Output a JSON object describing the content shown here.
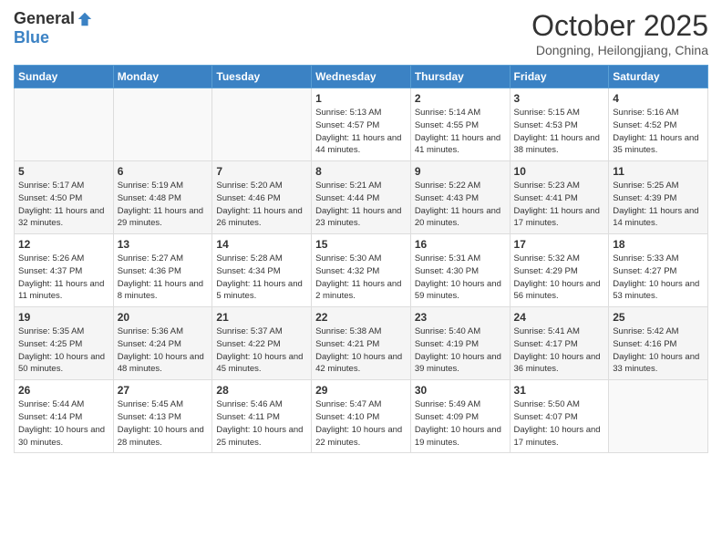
{
  "header": {
    "logo_general": "General",
    "logo_blue": "Blue",
    "month": "October 2025",
    "location": "Dongning, Heilongjiang, China"
  },
  "weekdays": [
    "Sunday",
    "Monday",
    "Tuesday",
    "Wednesday",
    "Thursday",
    "Friday",
    "Saturday"
  ],
  "weeks": [
    [
      {
        "day": "",
        "sunrise": "",
        "sunset": "",
        "daylight": ""
      },
      {
        "day": "",
        "sunrise": "",
        "sunset": "",
        "daylight": ""
      },
      {
        "day": "",
        "sunrise": "",
        "sunset": "",
        "daylight": ""
      },
      {
        "day": "1",
        "sunrise": "Sunrise: 5:13 AM",
        "sunset": "Sunset: 4:57 PM",
        "daylight": "Daylight: 11 hours and 44 minutes."
      },
      {
        "day": "2",
        "sunrise": "Sunrise: 5:14 AM",
        "sunset": "Sunset: 4:55 PM",
        "daylight": "Daylight: 11 hours and 41 minutes."
      },
      {
        "day": "3",
        "sunrise": "Sunrise: 5:15 AM",
        "sunset": "Sunset: 4:53 PM",
        "daylight": "Daylight: 11 hours and 38 minutes."
      },
      {
        "day": "4",
        "sunrise": "Sunrise: 5:16 AM",
        "sunset": "Sunset: 4:52 PM",
        "daylight": "Daylight: 11 hours and 35 minutes."
      }
    ],
    [
      {
        "day": "5",
        "sunrise": "Sunrise: 5:17 AM",
        "sunset": "Sunset: 4:50 PM",
        "daylight": "Daylight: 11 hours and 32 minutes."
      },
      {
        "day": "6",
        "sunrise": "Sunrise: 5:19 AM",
        "sunset": "Sunset: 4:48 PM",
        "daylight": "Daylight: 11 hours and 29 minutes."
      },
      {
        "day": "7",
        "sunrise": "Sunrise: 5:20 AM",
        "sunset": "Sunset: 4:46 PM",
        "daylight": "Daylight: 11 hours and 26 minutes."
      },
      {
        "day": "8",
        "sunrise": "Sunrise: 5:21 AM",
        "sunset": "Sunset: 4:44 PM",
        "daylight": "Daylight: 11 hours and 23 minutes."
      },
      {
        "day": "9",
        "sunrise": "Sunrise: 5:22 AM",
        "sunset": "Sunset: 4:43 PM",
        "daylight": "Daylight: 11 hours and 20 minutes."
      },
      {
        "day": "10",
        "sunrise": "Sunrise: 5:23 AM",
        "sunset": "Sunset: 4:41 PM",
        "daylight": "Daylight: 11 hours and 17 minutes."
      },
      {
        "day": "11",
        "sunrise": "Sunrise: 5:25 AM",
        "sunset": "Sunset: 4:39 PM",
        "daylight": "Daylight: 11 hours and 14 minutes."
      }
    ],
    [
      {
        "day": "12",
        "sunrise": "Sunrise: 5:26 AM",
        "sunset": "Sunset: 4:37 PM",
        "daylight": "Daylight: 11 hours and 11 minutes."
      },
      {
        "day": "13",
        "sunrise": "Sunrise: 5:27 AM",
        "sunset": "Sunset: 4:36 PM",
        "daylight": "Daylight: 11 hours and 8 minutes."
      },
      {
        "day": "14",
        "sunrise": "Sunrise: 5:28 AM",
        "sunset": "Sunset: 4:34 PM",
        "daylight": "Daylight: 11 hours and 5 minutes."
      },
      {
        "day": "15",
        "sunrise": "Sunrise: 5:30 AM",
        "sunset": "Sunset: 4:32 PM",
        "daylight": "Daylight: 11 hours and 2 minutes."
      },
      {
        "day": "16",
        "sunrise": "Sunrise: 5:31 AM",
        "sunset": "Sunset: 4:30 PM",
        "daylight": "Daylight: 10 hours and 59 minutes."
      },
      {
        "day": "17",
        "sunrise": "Sunrise: 5:32 AM",
        "sunset": "Sunset: 4:29 PM",
        "daylight": "Daylight: 10 hours and 56 minutes."
      },
      {
        "day": "18",
        "sunrise": "Sunrise: 5:33 AM",
        "sunset": "Sunset: 4:27 PM",
        "daylight": "Daylight: 10 hours and 53 minutes."
      }
    ],
    [
      {
        "day": "19",
        "sunrise": "Sunrise: 5:35 AM",
        "sunset": "Sunset: 4:25 PM",
        "daylight": "Daylight: 10 hours and 50 minutes."
      },
      {
        "day": "20",
        "sunrise": "Sunrise: 5:36 AM",
        "sunset": "Sunset: 4:24 PM",
        "daylight": "Daylight: 10 hours and 48 minutes."
      },
      {
        "day": "21",
        "sunrise": "Sunrise: 5:37 AM",
        "sunset": "Sunset: 4:22 PM",
        "daylight": "Daylight: 10 hours and 45 minutes."
      },
      {
        "day": "22",
        "sunrise": "Sunrise: 5:38 AM",
        "sunset": "Sunset: 4:21 PM",
        "daylight": "Daylight: 10 hours and 42 minutes."
      },
      {
        "day": "23",
        "sunrise": "Sunrise: 5:40 AM",
        "sunset": "Sunset: 4:19 PM",
        "daylight": "Daylight: 10 hours and 39 minutes."
      },
      {
        "day": "24",
        "sunrise": "Sunrise: 5:41 AM",
        "sunset": "Sunset: 4:17 PM",
        "daylight": "Daylight: 10 hours and 36 minutes."
      },
      {
        "day": "25",
        "sunrise": "Sunrise: 5:42 AM",
        "sunset": "Sunset: 4:16 PM",
        "daylight": "Daylight: 10 hours and 33 minutes."
      }
    ],
    [
      {
        "day": "26",
        "sunrise": "Sunrise: 5:44 AM",
        "sunset": "Sunset: 4:14 PM",
        "daylight": "Daylight: 10 hours and 30 minutes."
      },
      {
        "day": "27",
        "sunrise": "Sunrise: 5:45 AM",
        "sunset": "Sunset: 4:13 PM",
        "daylight": "Daylight: 10 hours and 28 minutes."
      },
      {
        "day": "28",
        "sunrise": "Sunrise: 5:46 AM",
        "sunset": "Sunset: 4:11 PM",
        "daylight": "Daylight: 10 hours and 25 minutes."
      },
      {
        "day": "29",
        "sunrise": "Sunrise: 5:47 AM",
        "sunset": "Sunset: 4:10 PM",
        "daylight": "Daylight: 10 hours and 22 minutes."
      },
      {
        "day": "30",
        "sunrise": "Sunrise: 5:49 AM",
        "sunset": "Sunset: 4:09 PM",
        "daylight": "Daylight: 10 hours and 19 minutes."
      },
      {
        "day": "31",
        "sunrise": "Sunrise: 5:50 AM",
        "sunset": "Sunset: 4:07 PM",
        "daylight": "Daylight: 10 hours and 17 minutes."
      },
      {
        "day": "",
        "sunrise": "",
        "sunset": "",
        "daylight": ""
      }
    ]
  ]
}
